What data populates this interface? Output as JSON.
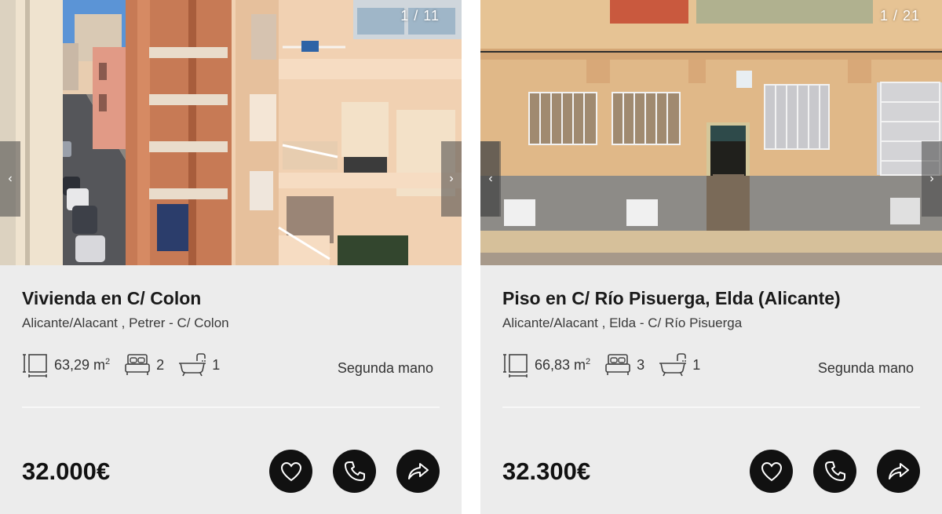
{
  "listings": [
    {
      "photo_counter": "1 / 11",
      "prev_arrow": "‹",
      "next_arrow": "›",
      "photo_alt": "Fachada del edificio en calle Colon",
      "title": "Vivienda en C/ Colon",
      "location": "Alicante/Alacant , Petrer - C/ Colon",
      "area": "63,29 m",
      "area_unit_exp": "2",
      "bedrooms": "2",
      "bathrooms": "1",
      "condition": "Segunda mano",
      "price": "32.000€",
      "actions": {
        "favorite_icon": "heart-icon",
        "call_icon": "phone-icon",
        "share_icon": "share-arrow-icon"
      }
    },
    {
      "photo_counter": "1 / 21",
      "prev_arrow": "‹",
      "next_arrow": "›",
      "photo_alt": "Fachada del edificio en calle Río Pisuerga",
      "title": "Piso en C/ Río Pisuerga, Elda (Alicante)",
      "location": "Alicante/Alacant , Elda - C/ Río Pisuerga",
      "area": "66,83 m",
      "area_unit_exp": "2",
      "bedrooms": "3",
      "bathrooms": "1",
      "condition": "Segunda mano",
      "price": "32.300€",
      "actions": {
        "favorite_icon": "heart-icon",
        "call_icon": "phone-icon",
        "share_icon": "share-arrow-icon"
      }
    }
  ],
  "colors": {
    "card_background": "#ececec",
    "action_button": "#111111",
    "divider": "#f7f7f7",
    "text_primary": "#1a1a1a"
  }
}
